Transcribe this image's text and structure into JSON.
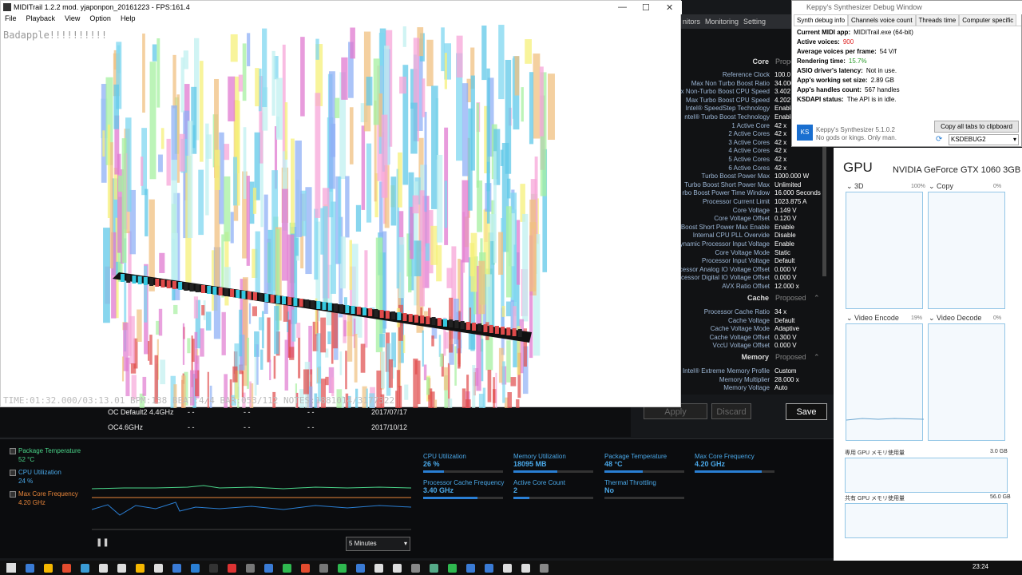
{
  "midi": {
    "title": "MIDITrail 1.2.2 mod. yjaponpon_20161223 - FPS:161.4",
    "menu": [
      "File",
      "Playback",
      "View",
      "Option",
      "Help"
    ],
    "overlay_text": "Badapple!!!!!!!!!!",
    "status_text": "TIME:01:32.000/03:13.01 BPM:138 BEAT:4/4 BAR:053/112 NOTES:1881014/3177322"
  },
  "xtu": {
    "tabs": [
      "nitors",
      "Monitoring",
      "Setting"
    ],
    "sections": [
      {
        "name": "Core",
        "proposed": "Propo"
      },
      {
        "name": "Cache",
        "proposed": "Proposed"
      },
      {
        "name": "Memory",
        "proposed": "Proposed"
      }
    ],
    "core_rows": [
      {
        "k": "Reference Clock",
        "v": "100.0"
      },
      {
        "k": "Max Non Turbo Boost Ratio",
        "v": "34.000"
      },
      {
        "k": "ax Non-Turbo Boost CPU Speed",
        "v": "3.402"
      },
      {
        "k": "Max Turbo Boost CPU Speed",
        "v": "4.202"
      },
      {
        "k": "Intel® SpeedStep Technology",
        "v": "Enable"
      },
      {
        "k": "ntel® Turbo Boost Technology",
        "v": "Enable"
      },
      {
        "k": "1 Active Core",
        "v": "42 x"
      },
      {
        "k": "2 Active Cores",
        "v": "42 x"
      },
      {
        "k": "3 Active Cores",
        "v": "42 x"
      },
      {
        "k": "4 Active Cores",
        "v": "42 x"
      },
      {
        "k": "5 Active Cores",
        "v": "42 x"
      },
      {
        "k": "6 Active Cores",
        "v": "42 x"
      },
      {
        "k": "Turbo Boost Power Max",
        "v": "1000.000 W"
      },
      {
        "k": "Turbo Boost Short Power Max",
        "v": "Unlimited"
      },
      {
        "k": "rbo Boost Power Time Window",
        "v": "16.000 Seconds"
      },
      {
        "k": "Processor Current Limit",
        "v": "1023.875 A"
      },
      {
        "k": "Core Voltage",
        "v": "1.149 V"
      },
      {
        "k": "Core Voltage Offset",
        "v": "0.120 V"
      },
      {
        "k": "Boost Short Power Max Enable",
        "v": "Enable"
      },
      {
        "k": "Internal CPU PLL Overvide",
        "v": "Disable"
      },
      {
        "k": "ynamic Processor Input Voltage",
        "v": "Enable"
      },
      {
        "k": "Core Voltage Mode",
        "v": "Static"
      },
      {
        "k": "Processor Input Voltage",
        "v": "Default"
      },
      {
        "k": "ocessor Analog IO Voltage Offset",
        "v": "0.000 V"
      },
      {
        "k": "ocessor Digital IO Voltage Offset",
        "v": "0.000 V"
      },
      {
        "k": "AVX Ratio Offset",
        "v": "12.000 x"
      }
    ],
    "cache_rows": [
      {
        "k": "Processor Cache Ratio",
        "v": "34 x"
      },
      {
        "k": "Cache Voltage",
        "v": "Default"
      },
      {
        "k": "Cache Voltage Mode",
        "v": "Adaptive"
      },
      {
        "k": "Cache Voltage Offset",
        "v": "0.300 V"
      },
      {
        "k": "VccU Voltage Offset",
        "v": "0.000 V"
      }
    ],
    "memory_rows": [
      {
        "k": "Intel® Extreme Memory Profile",
        "v": "Custom"
      },
      {
        "k": "Memory Multiplier",
        "v": "28.000 x"
      },
      {
        "k": "Memory Voltage",
        "v": "Auto"
      }
    ],
    "profiles": [
      {
        "name": "OC Default2 4.4GHz",
        "c1": "- -",
        "c2": "- -",
        "c3": "- -",
        "date": "2017/07/17"
      },
      {
        "name": "OC4.6GHz",
        "c1": "- -",
        "c2": "- -",
        "c3": "- -",
        "date": "2017/10/12"
      }
    ],
    "apply": "Apply",
    "discard": "Discard",
    "save": "Save",
    "legend": [
      {
        "t": "Package Temperature",
        "v": "52 °C",
        "color": "#4bd68a"
      },
      {
        "t": "CPU Utilization",
        "v": "24 %",
        "color": "#4aa8e8"
      },
      {
        "t": "Max Core Frequency",
        "v": "4.20 GHz",
        "color": "#e8863a"
      }
    ],
    "range": "5 Minutes",
    "stats": [
      {
        "l": "CPU Utilization",
        "v": "26 %",
        "fill": 0.26
      },
      {
        "l": "Memory Utilization",
        "v": "18095  MB",
        "fill": 0.55
      },
      {
        "l": "Package Temperature",
        "v": "48 °C",
        "fill": 0.48
      },
      {
        "l": "Max Core Frequency",
        "v": "4.20 GHz",
        "fill": 0.84
      },
      {
        "l": "Processor Cache Frequency",
        "v": "3.40 GHz",
        "fill": 0.68
      },
      {
        "l": "Active Core Count",
        "v": "2",
        "fill": 0.2
      },
      {
        "l": "Thermal Throttling",
        "v": "No",
        "fill": 0
      }
    ]
  },
  "synth": {
    "title": "Keppy's Synthesizer Debug Window",
    "tabs": [
      "Synth debug info",
      "Channels voice count",
      "Threads time",
      "Computer specific"
    ],
    "lines": [
      {
        "k": "Current MIDI app:",
        "v": "MIDITrail.exe (64-bit)",
        "color": "#000"
      },
      {
        "k": "Active voices:",
        "v": "900",
        "color": "#d22"
      },
      {
        "k": "Average voices per frame:",
        "v": "54 V/f",
        "color": "#000"
      },
      {
        "k": "Rendering time:",
        "v": "15.7%",
        "color": "#2a9a2a"
      },
      {
        "k": "ASIO driver's latency:",
        "v": "Not in use.",
        "color": "#000"
      },
      {
        "k": "App's working set size:",
        "v": "2.89 GB",
        "color": "#000"
      },
      {
        "k": "App's handles count:",
        "v": "567 handles",
        "color": "#000"
      },
      {
        "k": "KSDAPI status:",
        "v": "The API is in idle.",
        "color": "#000"
      }
    ],
    "version": "Keppy's Synthesizer 5.1.0.2",
    "motto": "No gods or kings. Only man.",
    "copy": "Copy all tabs to clipboard",
    "dropdown": "KSDEBUG2"
  },
  "tm": {
    "gpu": "GPU",
    "name": "NVIDIA GeForce GTX 1060 3GB",
    "panels": [
      {
        "label": "3D",
        "pct": "100%"
      },
      {
        "label": "Copy",
        "pct": "0%"
      },
      {
        "label": "Video Encode",
        "pct": "19%"
      },
      {
        "label": "Video Decode",
        "pct": "0%"
      }
    ],
    "dedicated": "専用 GPU メモリ使用量",
    "dedicated_max": "3.0 GB",
    "shared": "共有 GPU メモリ使用量",
    "shared_max": "56.0 GB"
  },
  "taskbar": {
    "time": "23:24"
  }
}
